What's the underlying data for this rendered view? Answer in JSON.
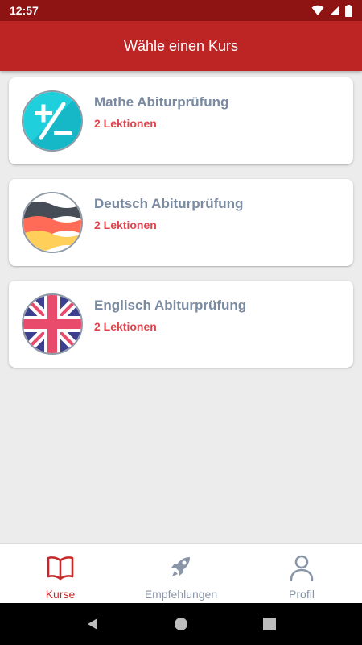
{
  "status_bar": {
    "time": "12:57"
  },
  "app_bar": {
    "title": "Wähle einen Kurs"
  },
  "courses": [
    {
      "title": "Mathe Abiturprüfung",
      "subtitle": "2 Lektionen",
      "icon": "math-icon"
    },
    {
      "title": "Deutsch Abiturprüfung",
      "subtitle": "2 Lektionen",
      "icon": "germany-flag-icon"
    },
    {
      "title": "Englisch Abiturprüfung",
      "subtitle": "2 Lektionen",
      "icon": "uk-flag-icon"
    }
  ],
  "bottom_nav": {
    "items": [
      {
        "label": "Kurse",
        "icon": "book-icon",
        "active": true
      },
      {
        "label": "Empfehlungen",
        "icon": "rocket-icon",
        "active": false
      },
      {
        "label": "Profil",
        "icon": "person-icon",
        "active": false
      }
    ]
  },
  "colors": {
    "status_bar": "#8e1414",
    "app_bar": "#bd2525",
    "accent": "#c62828",
    "subtitle": "#e0454e",
    "title_text": "#7a8aa0",
    "background": "#ececec"
  }
}
